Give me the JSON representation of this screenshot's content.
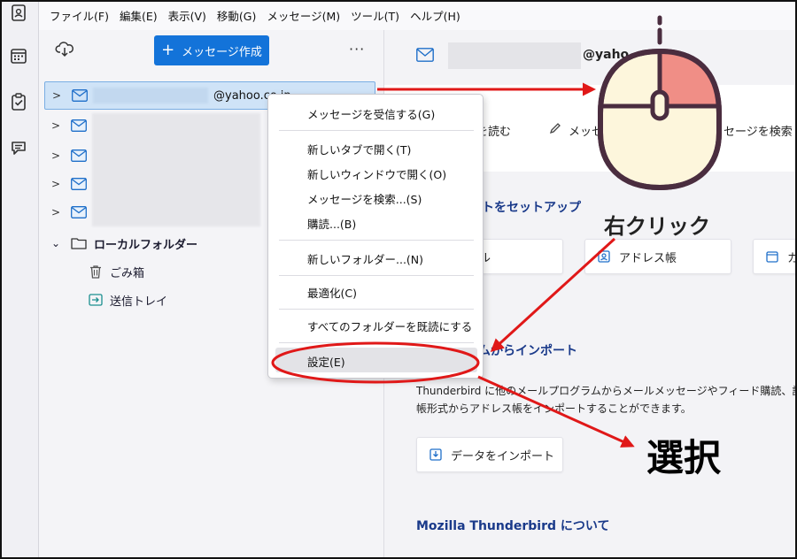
{
  "menubar": {
    "items": [
      "ファイル(F)",
      "編集(E)",
      "表示(V)",
      "移動(G)",
      "メッセージ(M)",
      "ツール(T)",
      "ヘルプ(H)"
    ]
  },
  "toolbar": {
    "compose_label": "メッセージ作成",
    "more_label": "···"
  },
  "folder_tree": {
    "account_label": "@yahoo.co.jp",
    "local_folders_label": "ローカルフォルダー",
    "trash_label": "ごみ箱",
    "outbox_label": "送信トレイ"
  },
  "context_menu": {
    "items": [
      "メッセージを受信する(G)",
      "新しいタブで開く(T)",
      "新しいウィンドウで開く(O)",
      "メッセージを検索...(S)",
      "購読...(B)",
      "新しいフォルダー...(N)",
      "最適化(C)",
      "すべてのフォルダーを既読にする",
      "設定(E)"
    ]
  },
  "main": {
    "account_domain": "@yaho",
    "actions": [
      "を読む",
      "メッセー",
      "ッセージを検索"
    ],
    "setup_title": "ットをセットアップ",
    "setup_buttons": [
      "ル",
      "アドレス帳",
      "カ"
    ],
    "import_title": "ムからインポート",
    "import_paragraph_1": "Thunderbird に他のメールプログラムからメールメッセージやフィード購読、設定、",
    "import_paragraph_2": "帳形式からアドレス帳をインポートすることができます。",
    "import_button": "データをインポート",
    "about_title": "Mozilla Thunderbird について"
  },
  "annotations": {
    "right_click": "右クリック",
    "select": "選択"
  },
  "colors": {
    "accent": "#1373d9",
    "annotation_red": "#e01818",
    "mouse_body": "#fdf6dc",
    "mouse_button": "#f08e86",
    "mouse_outline": "#4a2d3f",
    "heading_blue": "#1a3a8a"
  }
}
